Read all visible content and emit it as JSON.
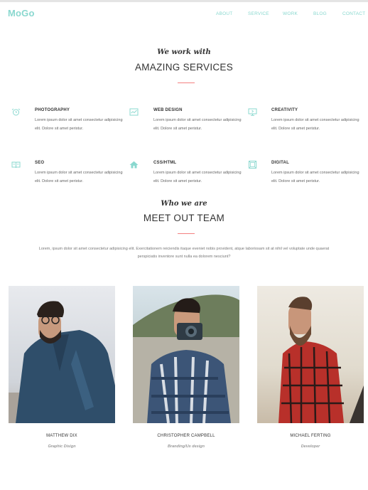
{
  "header": {
    "logo": "MoGo",
    "nav": [
      "ABOUT",
      "SERVICE",
      "WORK",
      "BLOG",
      "CONTACT"
    ]
  },
  "services_section": {
    "eyebrow": "We work with",
    "title": "AMAZING SERVICES",
    "items": [
      {
        "title": "PHOTOGRAPHY",
        "text": "Lorem ipsum dolor sit amet consectetur adipisicing elit. Dolore sit amet peristur.",
        "icon": "alarm-clock-icon"
      },
      {
        "title": "WEB DESIGN",
        "text": "Lorem ipsum dolor sit amet consectetur adipisicing elit. Dolore sit amet peristur.",
        "icon": "chart-window-icon"
      },
      {
        "title": "CREATIVITY",
        "text": "Lorem ipsum dolor sit amet consectetur adipisicing elit. Dolore sit amet peristur.",
        "icon": "monitor-icon"
      },
      {
        "title": "SEO",
        "text": "Lorem ipsum dolor sit amet consectetur adipisicing elit. Dolore sit amet peristur.",
        "icon": "book-icon"
      },
      {
        "title": "CSS/HTML",
        "text": "Lorem ipsum dolor sit amet consectetur adipisicing elit. Dolore sit amet peristur.",
        "icon": "home-icon"
      },
      {
        "title": "DIGITAL",
        "text": "Lorem ipsum dolor sit amet consectetur adipisicing elit. Dolore sit amet peristur.",
        "icon": "frame-icon"
      }
    ]
  },
  "team_section": {
    "eyebrow": "Who we are",
    "title": "MEET OUT TEAM",
    "intro": "Lorem, ipsum dolor sit amet consectetur adipisicing elit. Exercitationem reiciendis itaque eveniet nobis provident, atque laboriosam sit at nihil vel voluptate unde quaerat perspiciatis inventore sunt nulla ea dolorem nesciunt?",
    "members": [
      {
        "name": "MATTHEW DIX",
        "role": "Graphic Disign"
      },
      {
        "name": "CHRISTOPHER CAMPBELL",
        "role": "Branding/Ux design"
      },
      {
        "name": "MICHAEL FERTING",
        "role": "Developer"
      }
    ]
  },
  "colors": {
    "accent": "#8ad8cf",
    "divider": "#f38181",
    "text": "#333333",
    "muted": "#666666"
  }
}
